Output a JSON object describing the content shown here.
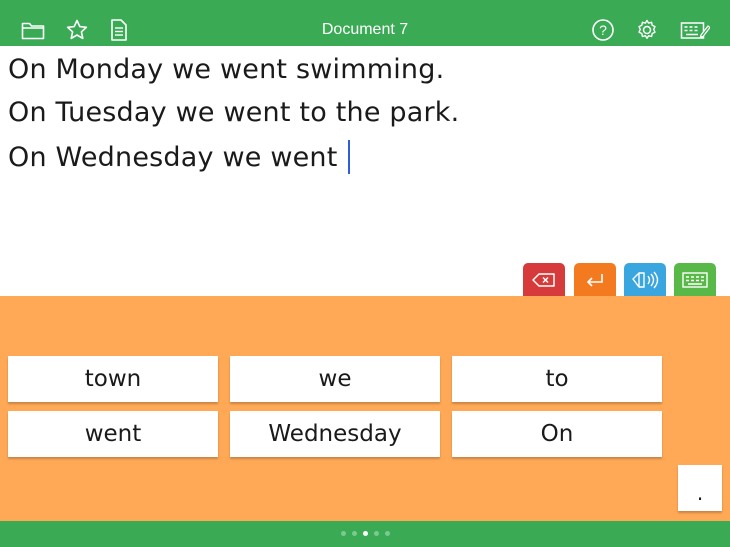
{
  "header": {
    "title": "Document 7",
    "left_icons": [
      "folder-icon",
      "star-icon",
      "document-icon"
    ],
    "right_icons": [
      "help-icon",
      "settings-icon",
      "keyboard-edit-icon"
    ]
  },
  "document": {
    "lines": [
      "On Monday we went swimming.",
      "On Tuesday we went to the park.",
      "On Wednesday we went"
    ]
  },
  "actions": [
    {
      "name": "delete",
      "icon": "backspace-icon",
      "color": "#d63a3a"
    },
    {
      "name": "enter",
      "icon": "return-icon",
      "color": "#f47a20"
    },
    {
      "name": "speak",
      "icon": "speaker-icon",
      "color": "#3aa6e0"
    },
    {
      "name": "keyboard",
      "icon": "keyboard-icon",
      "color": "#58b848"
    }
  ],
  "words": {
    "row1": [
      "town",
      "we",
      "to"
    ],
    "row2": [
      "went",
      "Wednesday",
      "On"
    ]
  },
  "punctuation": ".",
  "pager": {
    "count": 5,
    "current": 3
  },
  "colors": {
    "bar": "#3aaa55",
    "panel": "#ffa957",
    "caret": "#2e5fd8"
  }
}
